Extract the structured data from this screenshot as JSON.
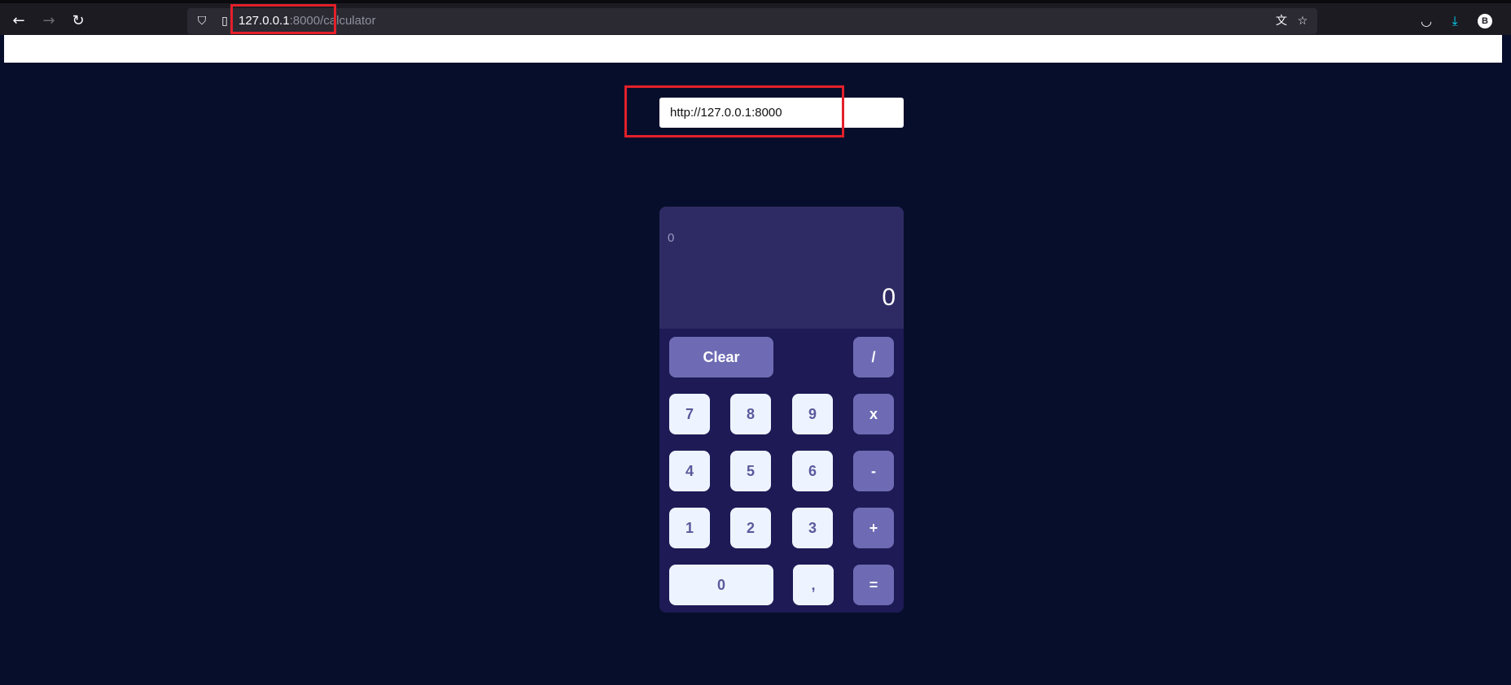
{
  "browser": {
    "back_icon": "←",
    "forward_icon": "→",
    "reload_icon": "↻",
    "shield_icon": "⛉",
    "page_icon": "▯",
    "url_host": "127.0.0.1",
    "url_path": ":8000/calculator",
    "translate_icon": "文",
    "bookmark_icon": "☆",
    "pocket_icon": "◡",
    "download_icon": "⤓",
    "account_initial": "B"
  },
  "api_input": {
    "value": "http://127.0.0.1:8000"
  },
  "calculator": {
    "previous": "0",
    "current": "0",
    "keys": {
      "clear": "Clear",
      "divide": "/",
      "multiply": "x",
      "subtract": "-",
      "add": "+",
      "equals": "=",
      "decimal": ",",
      "n0": "0",
      "n1": "1",
      "n2": "2",
      "n3": "3",
      "n4": "4",
      "n5": "5",
      "n6": "6",
      "n7": "7",
      "n8": "8",
      "n9": "9"
    }
  },
  "colors": {
    "page_background": "#070e2b",
    "calculator_body": "#1e1a55",
    "display": "#2e2b64",
    "operator_key": "#6e6bb4",
    "number_key": "#eef4ff",
    "highlight": "#e3202a"
  }
}
